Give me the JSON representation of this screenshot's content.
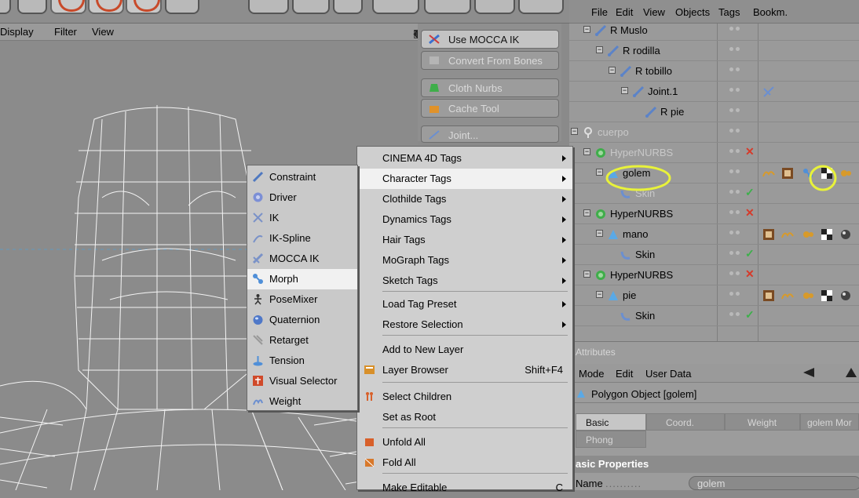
{
  "viewport": {
    "menu": [
      "Display",
      "Filter",
      "View"
    ],
    "icons": [
      "move-icon",
      "vertical-arrow-icon",
      "rotate-icon",
      "maximize-icon"
    ]
  },
  "side_tools": [
    {
      "label": "Use MOCCA IK",
      "icon": "mocca-ik-icon",
      "enabled": true
    },
    {
      "label": "Convert From Bones",
      "icon": "convert-icon",
      "enabled": false
    },
    {
      "label": "Cloth Nurbs",
      "icon": "cloth-icon",
      "enabled": false
    },
    {
      "label": "Cache Tool",
      "icon": "cache-icon",
      "enabled": false
    },
    {
      "label": "Joint...",
      "icon": "joint-icon",
      "enabled": false
    }
  ],
  "object_manager": {
    "menu": [
      "File",
      "Edit",
      "View",
      "Objects",
      "Tags",
      "Bookm."
    ],
    "rows": [
      {
        "name": "R Muslo",
        "indent": 1,
        "icon": "joint-icon",
        "gray": false
      },
      {
        "name": "R rodilla",
        "indent": 2,
        "icon": "joint-icon",
        "gray": false
      },
      {
        "name": "R tobillo",
        "indent": 3,
        "icon": "joint-icon",
        "gray": false
      },
      {
        "name": "Joint.1",
        "indent": 4,
        "icon": "joint-icon",
        "gray": false
      },
      {
        "name": "R pie",
        "indent": 5,
        "icon": "joint-icon",
        "gray": false
      },
      {
        "name": "cuerpo",
        "indent": 0,
        "icon": "null-icon",
        "gray": true
      },
      {
        "name": "HyperNURBS",
        "indent": 1,
        "icon": "hypernurbs-icon",
        "gray": true
      },
      {
        "name": "golem",
        "indent": 2,
        "icon": "polygon-icon",
        "gray": false
      },
      {
        "name": "Skin",
        "indent": 3,
        "icon": "skin-icon",
        "gray": true
      },
      {
        "name": "HyperNURBS",
        "indent": 1,
        "icon": "hypernurbs-icon",
        "gray": false
      },
      {
        "name": "mano",
        "indent": 2,
        "icon": "polygon-icon",
        "gray": false
      },
      {
        "name": "Skin",
        "indent": 3,
        "icon": "skin-icon",
        "gray": false
      },
      {
        "name": "HyperNURBS",
        "indent": 1,
        "icon": "hypernurbs-icon",
        "gray": false
      },
      {
        "name": "pie",
        "indent": 2,
        "icon": "polygon-icon",
        "gray": false
      },
      {
        "name": "Skin",
        "indent": 3,
        "icon": "skin-icon",
        "gray": false
      }
    ]
  },
  "attributes": {
    "header": "Attributes",
    "menu": [
      "Mode",
      "Edit",
      "User Data"
    ],
    "object_label": "Polygon Object [golem]",
    "tabs": [
      "Basic",
      "Coord.",
      "Weight",
      "golem Mor",
      "Phong"
    ],
    "active_tab": "Basic",
    "section": "asic Properties",
    "name_label": "Name",
    "name_value": "golem"
  },
  "context_menu": {
    "items": [
      {
        "label": "CINEMA 4D Tags",
        "submenu": true
      },
      {
        "label": "Character Tags",
        "submenu": true,
        "highlight": true
      },
      {
        "label": "Clothilde Tags",
        "submenu": true
      },
      {
        "label": "Dynamics Tags",
        "submenu": true
      },
      {
        "label": "Hair Tags",
        "submenu": true
      },
      {
        "label": "MoGraph Tags",
        "submenu": true
      },
      {
        "label": "Sketch Tags",
        "submenu": true
      },
      {
        "label": "Load Tag Preset",
        "submenu": true
      },
      {
        "label": "Restore Selection",
        "submenu": true
      },
      {
        "label": "Add to New Layer"
      },
      {
        "label": "Layer Browser",
        "shortcut": "Shift+F4",
        "icon": "layer-browser-icon"
      },
      {
        "label": "Select Children",
        "icon": "select-children-icon"
      },
      {
        "label": "Set as Root"
      },
      {
        "label": "Unfold All",
        "icon": "unfold-icon"
      },
      {
        "label": "Fold All",
        "icon": "fold-icon"
      },
      {
        "label": "Make Editable",
        "shortcut": "C"
      }
    ]
  },
  "submenu": {
    "items": [
      {
        "label": "Constraint",
        "icon": "constraint-icon"
      },
      {
        "label": "Driver",
        "icon": "driver-icon"
      },
      {
        "label": "IK",
        "icon": "ik-icon"
      },
      {
        "label": "IK-Spline",
        "icon": "ik-spline-icon"
      },
      {
        "label": "MOCCA IK",
        "icon": "mocca-ik-icon"
      },
      {
        "label": "Morph",
        "icon": "morph-icon",
        "highlight": true
      },
      {
        "label": "PoseMixer",
        "icon": "posemixer-icon"
      },
      {
        "label": "Quaternion",
        "icon": "quaternion-icon"
      },
      {
        "label": "Retarget",
        "icon": "retarget-icon"
      },
      {
        "label": "Tension",
        "icon": "tension-icon"
      },
      {
        "label": "Visual Selector",
        "icon": "visual-selector-icon"
      },
      {
        "label": "Weight",
        "icon": "weight-icon"
      }
    ]
  },
  "colors": {
    "highlight_circle": "#e8f23a",
    "red_tag": "#d63a2a",
    "green_check": "#3cb04a"
  }
}
